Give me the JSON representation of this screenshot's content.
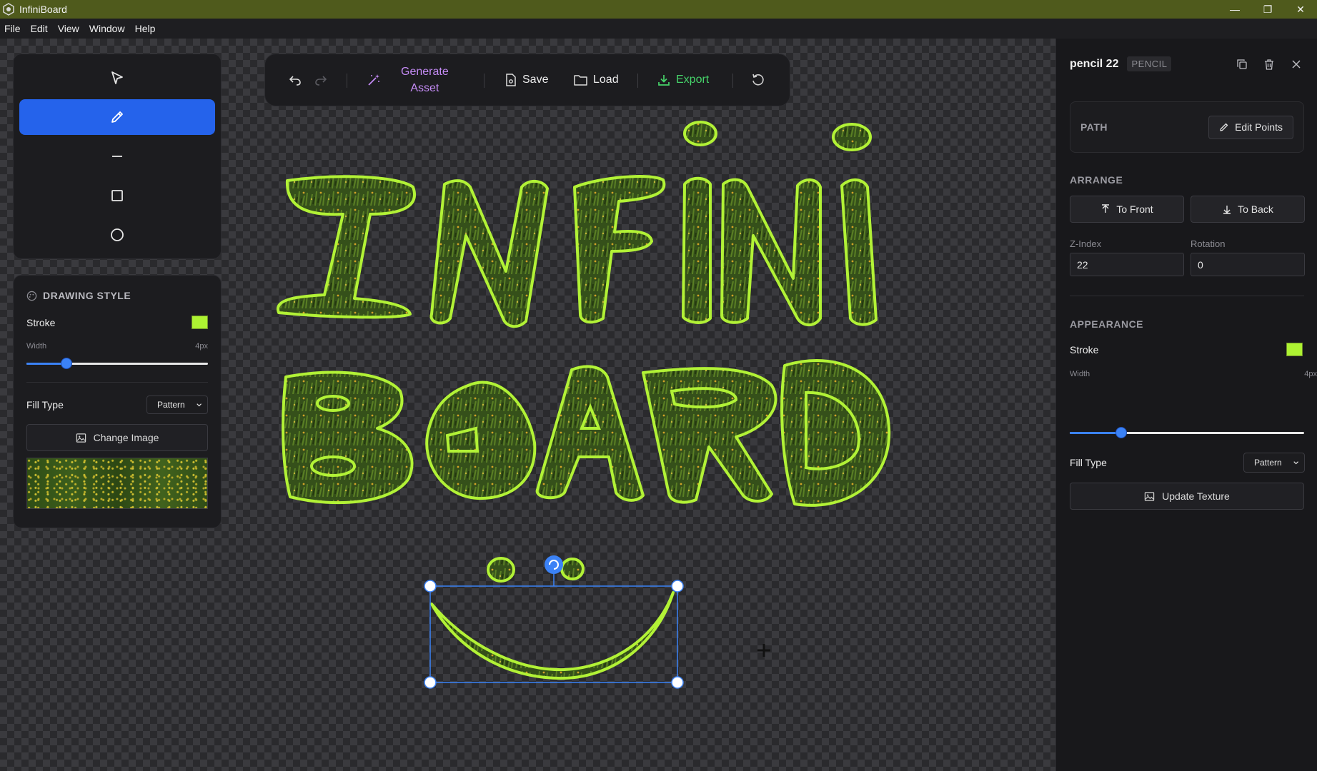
{
  "window": {
    "title": "InfiniBoard",
    "controls": {
      "minimize": "—",
      "maximize": "❐",
      "close": "✕"
    }
  },
  "menu": [
    "File",
    "Edit",
    "View",
    "Window",
    "Help"
  ],
  "tools": [
    {
      "name": "select",
      "icon": "cursor-arrow-icon",
      "active": false
    },
    {
      "name": "pencil",
      "icon": "pencil-icon",
      "active": true
    },
    {
      "name": "line",
      "icon": "line-icon",
      "active": false
    },
    {
      "name": "rectangle",
      "icon": "square-icon",
      "active": false
    },
    {
      "name": "ellipse",
      "icon": "circle-icon",
      "active": false
    }
  ],
  "toolbar": {
    "generate_line1": "Generate",
    "generate_line2": "Asset",
    "save": "Save",
    "load": "Load",
    "export": "Export"
  },
  "drawing_style": {
    "title": "DRAWING STYLE",
    "stroke_label": "Stroke",
    "stroke_color": "#adf232",
    "width_label": "Width",
    "width_value": "4px",
    "width_fraction": 0.22,
    "fill_label": "Fill Type",
    "fill_value": "Pattern",
    "change_image": "Change Image"
  },
  "properties": {
    "title": "pencil 22",
    "type_badge": "PENCIL",
    "path_title": "PATH",
    "edit_points": "Edit Points",
    "arrange_title": "ARRANGE",
    "to_front": "To Front",
    "to_back": "To Back",
    "zindex_label": "Z-Index",
    "zindex_value": "22",
    "rotation_label": "Rotation",
    "rotation_value": "0",
    "appearance_title": "APPEARANCE",
    "stroke_label": "Stroke",
    "stroke_color": "#adf232",
    "width_label": "Width",
    "width_value": "4px",
    "width_fraction": 0.22,
    "fill_label": "Fill Type",
    "fill_value": "Pattern",
    "update_texture": "Update Texture"
  },
  "colors": {
    "accent": "#2563eb",
    "stroke": "#adf232",
    "export": "#46d36a",
    "generate": "#c48bf5",
    "titlebar": "#4f5a1c"
  }
}
